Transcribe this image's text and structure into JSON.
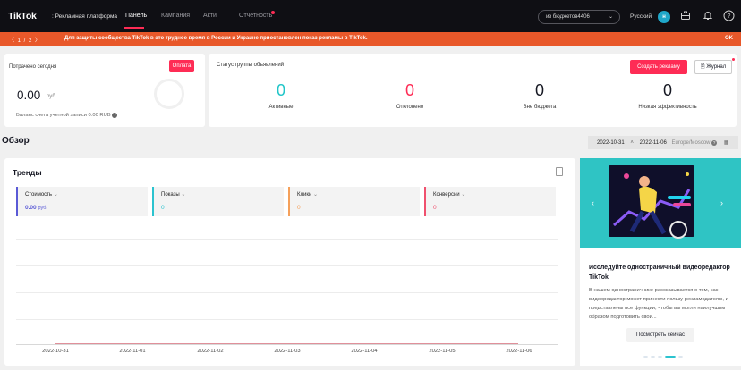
{
  "topbar": {
    "logo": "TikTok",
    "logo_sub": ": Рекламная платформа",
    "nav": [
      {
        "label": "Панель",
        "active": true
      },
      {
        "label": "Кампания",
        "active": false
      },
      {
        "label": "Акти",
        "active": false
      },
      {
        "label": "Отчетность",
        "active": false
      }
    ],
    "account": "из бюджетов4406",
    "language": "Русский",
    "avatar_letter": "н",
    "icons": [
      "briefcase-icon",
      "bell-icon",
      "help-icon"
    ]
  },
  "banner": {
    "pager": "〈  1 / 2  〉",
    "message": "Для защиты сообщества TikTok в это трудное время в России и Украине приостановлен показ рекламы в TikTok.",
    "ok": "OK"
  },
  "spend": {
    "title": "Потрачено сегодня",
    "pay_button": "Оплата",
    "amount": "0.00",
    "currency": "руб.",
    "balance": "Баланс счета учетной записи 0.00 RUB"
  },
  "status": {
    "title": "Статус группы объявлений",
    "create_button": "Создать рекламу",
    "journal_button": "Журнал",
    "items": [
      {
        "value": "0",
        "label": "Активные",
        "color": "#20c5c8"
      },
      {
        "value": "0",
        "label": "Отклонено",
        "color": "#fe2c55"
      },
      {
        "value": "0",
        "label": "Вне бюджета",
        "color": "#161823"
      },
      {
        "value": "0",
        "label": "Низкая эффективность",
        "color": "#161823"
      }
    ]
  },
  "overview": {
    "title": "Обзор",
    "date_from": "2022-10-31",
    "date_to": "2022-11-06",
    "timezone": "Europe/Moscow"
  },
  "trends": {
    "title": "Тренды",
    "metrics": [
      {
        "name": "Стоимость",
        "value": "0.00",
        "unit": "руб.",
        "color": "#5a5ad6"
      },
      {
        "name": "Показы",
        "value": "0",
        "unit": "",
        "color": "#2bc3cf"
      },
      {
        "name": "Клики",
        "value": "0",
        "unit": "",
        "color": "#f5a05a"
      },
      {
        "name": "Конверсии",
        "value": "0",
        "unit": "",
        "color": "#f0506e"
      }
    ],
    "x_ticks": [
      "2022-10-31",
      "2022-11-01",
      "2022-11-02",
      "2022-11-03",
      "2022-11-04",
      "2022-11-05",
      "2022-11-06"
    ]
  },
  "promo": {
    "title": "Исследуйте одностраничный видеоредактор TikTok",
    "text": "В нашем одностраничнике рассказывается о том, как видеоредактор может принести пользу рекламодателю, и представлены все функции, чтобы вы могли наилучшим образом подготовить свои...",
    "button": "Посмотреть сейчас",
    "slides": 5,
    "active_slide": 4
  }
}
